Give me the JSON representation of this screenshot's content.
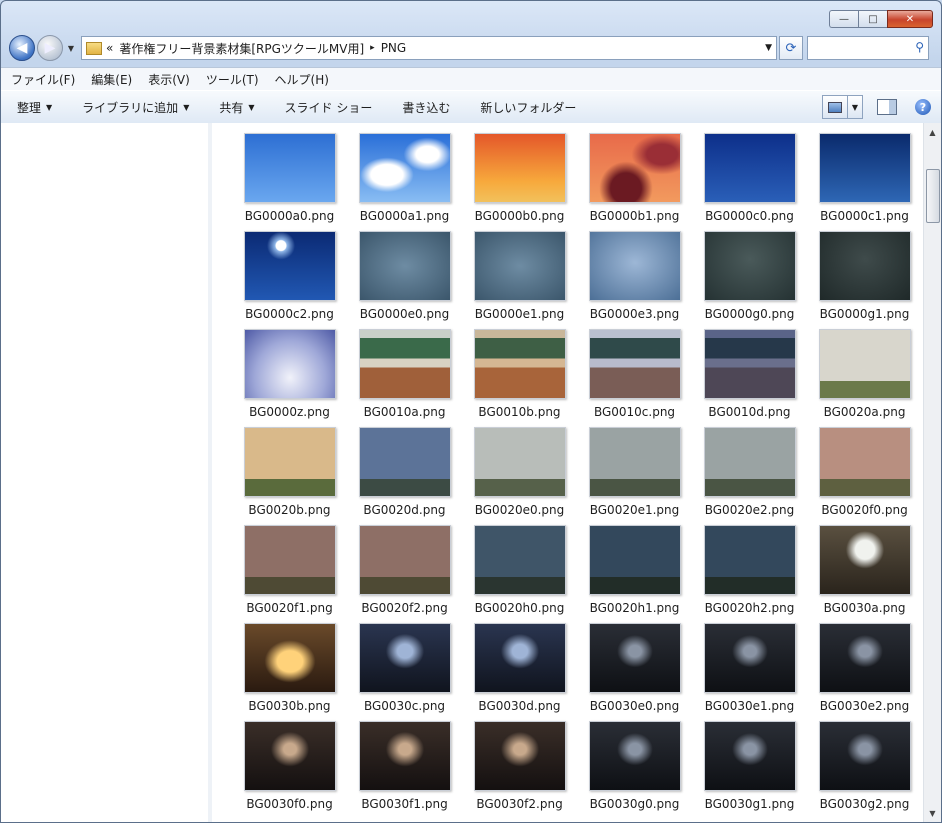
{
  "window": {
    "caption": {
      "minimize": "—",
      "maximize": "□",
      "close": "✕"
    }
  },
  "address": {
    "chevron": "«",
    "segments": [
      "著作権フリー背景素材集[RPGツクールMV用]",
      "PNG"
    ],
    "separator": "▸",
    "search_placeholder": ""
  },
  "menu": [
    "ファイル(F)",
    "編集(E)",
    "表示(V)",
    "ツール(T)",
    "ヘルプ(H)"
  ],
  "toolbar": {
    "organize": "整理",
    "add_library": "ライブラリに追加",
    "share": "共有",
    "slideshow": "スライド ショー",
    "burn": "書き込む",
    "new_folder": "新しいフォルダー"
  },
  "files": [
    {
      "name": "BG0000a0.png",
      "thumb": "sky1"
    },
    {
      "name": "BG0000a1.png",
      "thumb": "sky2"
    },
    {
      "name": "BG0000b0.png",
      "thumb": "sunset"
    },
    {
      "name": "BG0000b1.png",
      "thumb": "sunset2"
    },
    {
      "name": "BG0000c0.png",
      "thumb": "deep"
    },
    {
      "name": "BG0000c1.png",
      "thumb": "night"
    },
    {
      "name": "BG0000c2.png",
      "thumb": "moon"
    },
    {
      "name": "BG0000e0.png",
      "thumb": "cloudgray"
    },
    {
      "name": "BG0000e1.png",
      "thumb": "cloudgray"
    },
    {
      "name": "BG0000e3.png",
      "thumb": "cloudblue"
    },
    {
      "name": "BG0000g0.png",
      "thumb": "dark1"
    },
    {
      "name": "BG0000g1.png",
      "thumb": "dark2"
    },
    {
      "name": "BG0000z.png",
      "thumb": "zsky"
    },
    {
      "name": "BG0010a.png",
      "thumb": "class1"
    },
    {
      "name": "BG0010b.png",
      "thumb": "class2"
    },
    {
      "name": "BG0010c.png",
      "thumb": "class3"
    },
    {
      "name": "BG0010d.png",
      "thumb": "class4"
    },
    {
      "name": "BG0020a.png",
      "thumb": "wallday"
    },
    {
      "name": "BG0020b.png",
      "thumb": "wallsun"
    },
    {
      "name": "BG0020d.png",
      "thumb": "wallblue"
    },
    {
      "name": "BG0020e0.png",
      "thumb": "wallgray1"
    },
    {
      "name": "BG0020e1.png",
      "thumb": "wallgray2"
    },
    {
      "name": "BG0020e2.png",
      "thumb": "wallgray2"
    },
    {
      "name": "BG0020f0.png",
      "thumb": "wallpink"
    },
    {
      "name": "BG0020f1.png",
      "thumb": "wallbrown"
    },
    {
      "name": "BG0020f2.png",
      "thumb": "wallbrown"
    },
    {
      "name": "BG0020h0.png",
      "thumb": "wallnight1"
    },
    {
      "name": "BG0020h1.png",
      "thumb": "wallnight2"
    },
    {
      "name": "BG0020h2.png",
      "thumb": "wallnight2"
    },
    {
      "name": "BG0030a.png",
      "thumb": "shedday"
    },
    {
      "name": "BG0030b.png",
      "thumb": "shedsun"
    },
    {
      "name": "BG0030c.png",
      "thumb": "shedblue"
    },
    {
      "name": "BG0030d.png",
      "thumb": "shedblue"
    },
    {
      "name": "BG0030e0.png",
      "thumb": "sheddark"
    },
    {
      "name": "BG0030e1.png",
      "thumb": "sheddark"
    },
    {
      "name": "BG0030e2.png",
      "thumb": "sheddark"
    },
    {
      "name": "BG0030f0.png",
      "thumb": "shedwarm"
    },
    {
      "name": "BG0030f1.png",
      "thumb": "shedwarm"
    },
    {
      "name": "BG0030f2.png",
      "thumb": "shedwarm"
    },
    {
      "name": "BG0030g0.png",
      "thumb": "sheddark"
    },
    {
      "name": "BG0030g1.png",
      "thumb": "sheddark"
    },
    {
      "name": "BG0030g2.png",
      "thumb": "sheddark"
    }
  ]
}
